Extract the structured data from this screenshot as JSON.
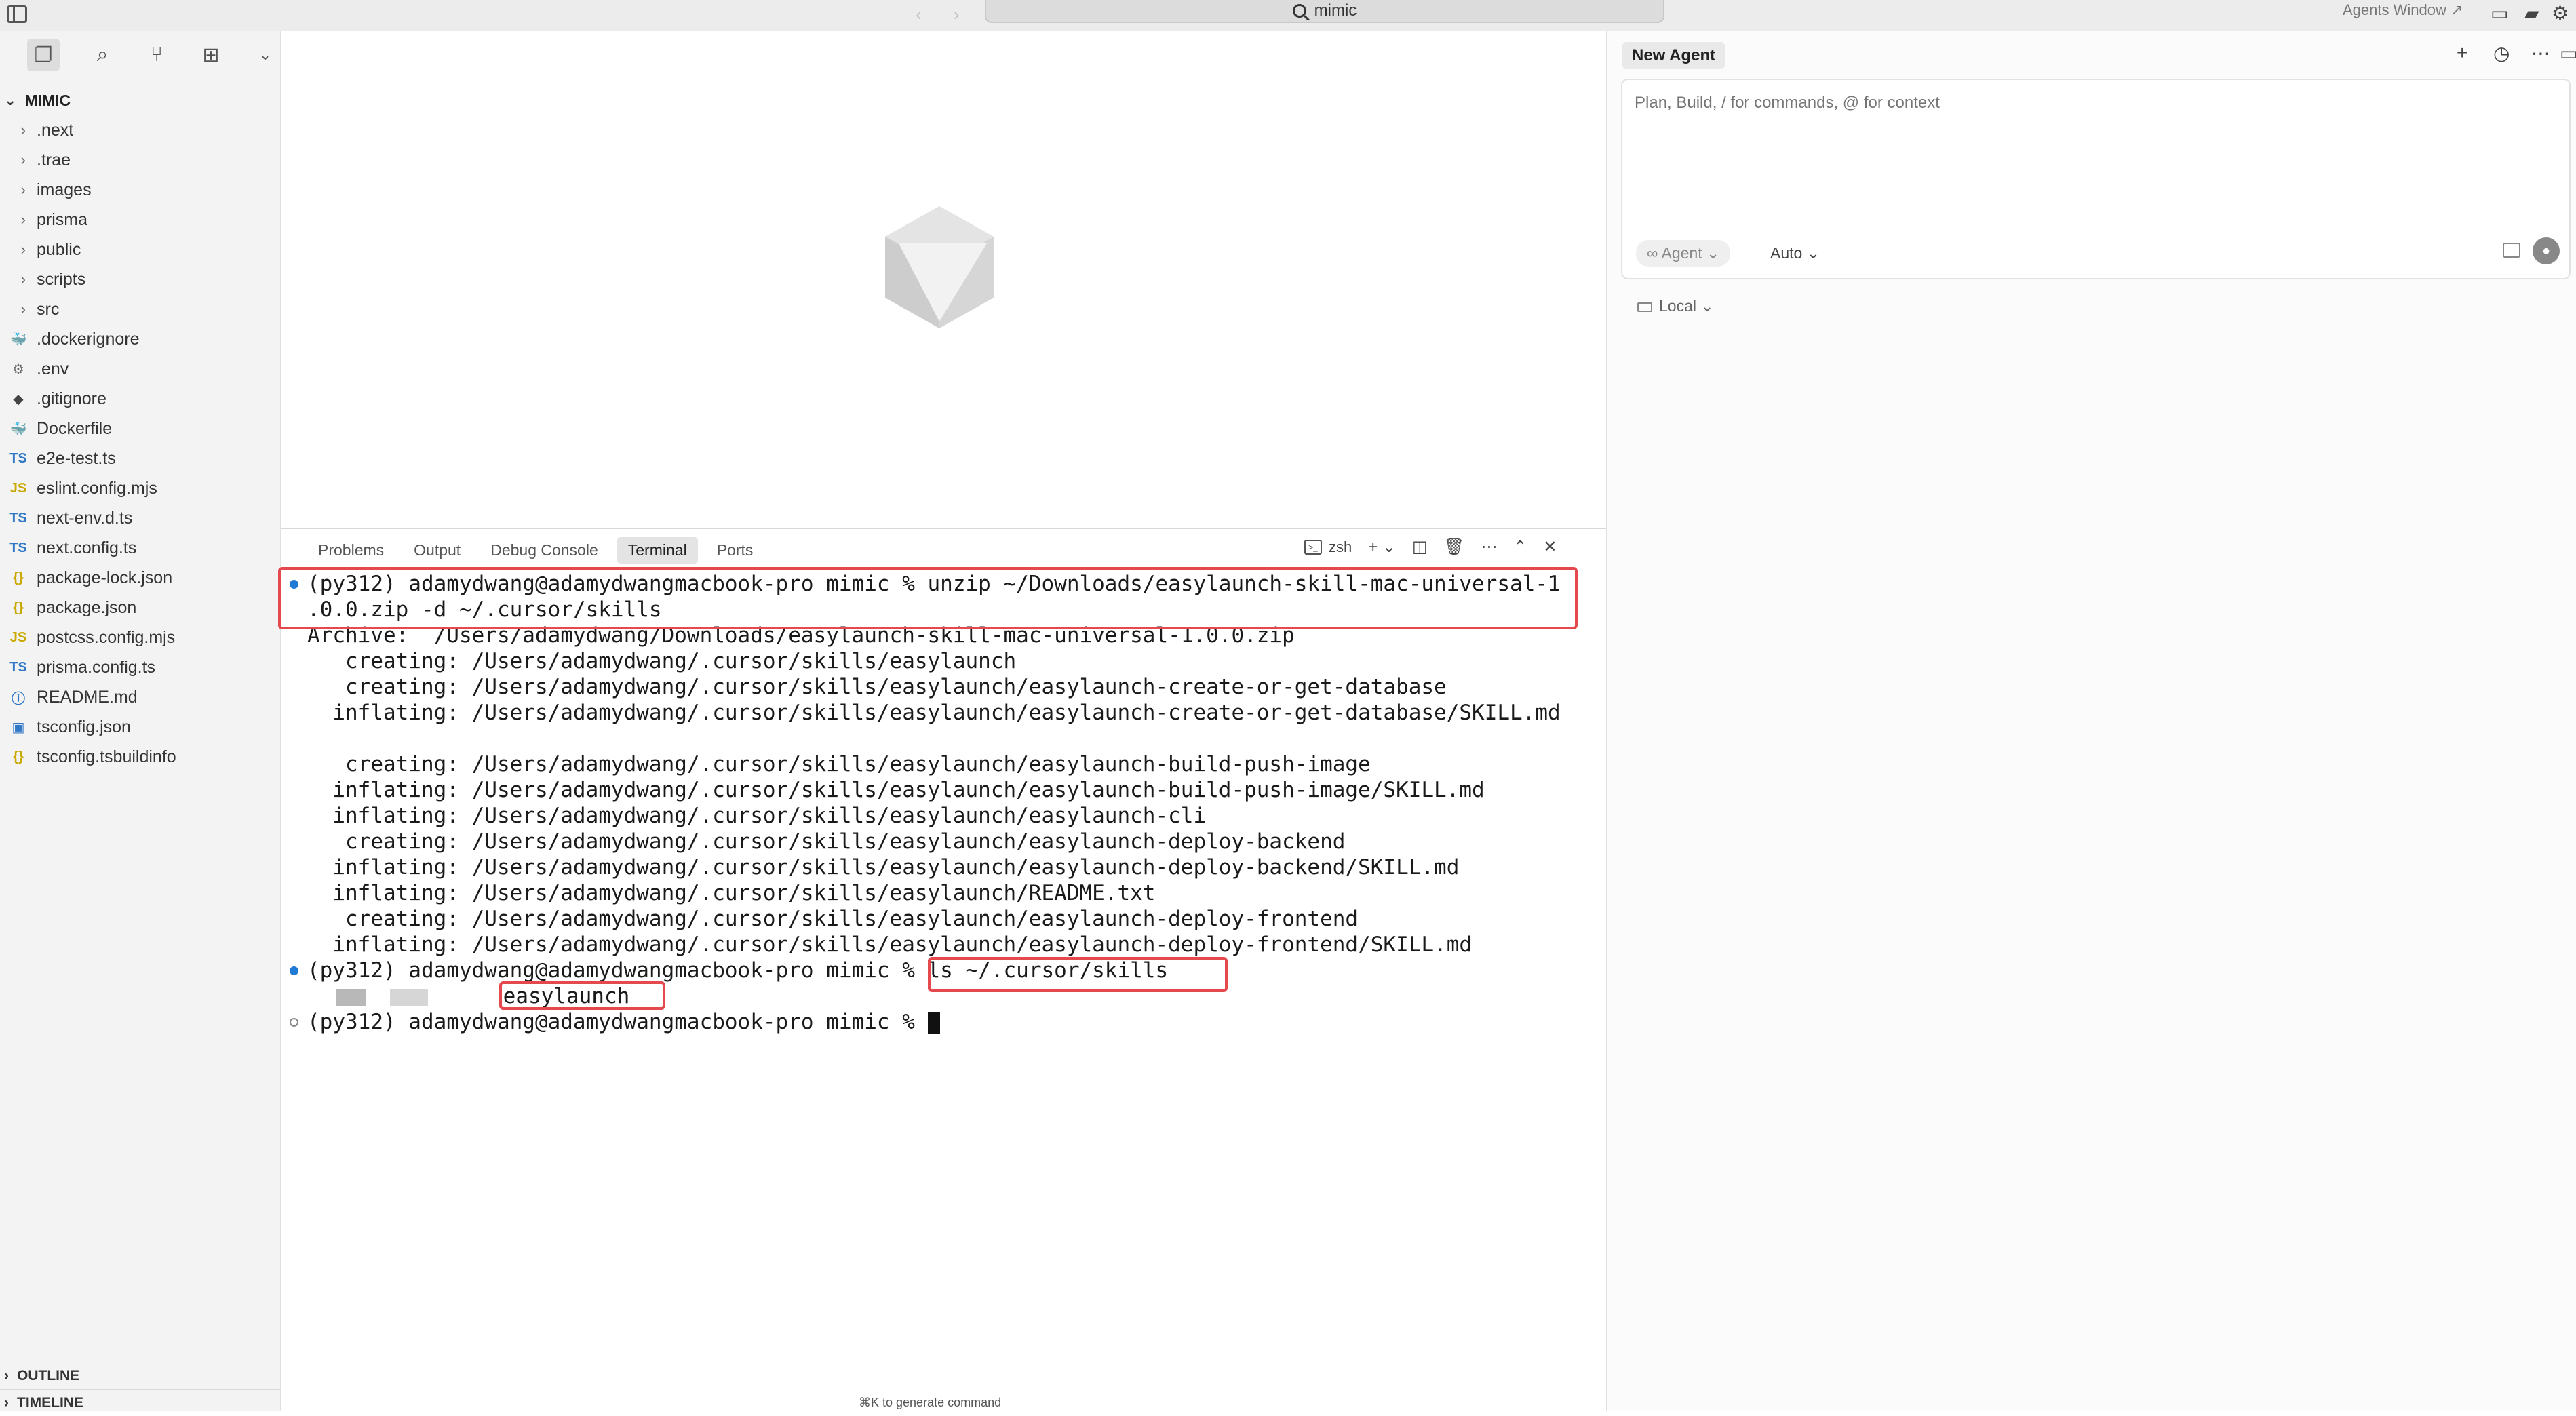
{
  "titlebar": {
    "search_text": "mimic",
    "agents_window_label": "Agents Window ↗"
  },
  "sidebar": {
    "root_label": "MIMIC",
    "items": [
      {
        "label": ".next",
        "type": "folder"
      },
      {
        "label": ".trae",
        "type": "folder"
      },
      {
        "label": "images",
        "type": "folder"
      },
      {
        "label": "prisma",
        "type": "folder"
      },
      {
        "label": "public",
        "type": "folder"
      },
      {
        "label": "scripts",
        "type": "folder"
      },
      {
        "label": "src",
        "type": "folder"
      },
      {
        "label": ".dockerignore",
        "type": "file",
        "icon": "docker-icon",
        "icon_text": "🐳",
        "color": "#3b87c9"
      },
      {
        "label": ".env",
        "type": "file",
        "icon": "gear-icon",
        "icon_text": "⚙",
        "color": "#666666"
      },
      {
        "label": ".gitignore",
        "type": "file",
        "icon": "git-icon",
        "icon_text": "◆",
        "color": "#444444"
      },
      {
        "label": "Dockerfile",
        "type": "file",
        "icon": "docker-icon",
        "icon_text": "🐳",
        "color": "#3b87c9"
      },
      {
        "label": "e2e-test.ts",
        "type": "file",
        "icon": "typescript-icon",
        "icon_text": "TS",
        "color": "#3178c6"
      },
      {
        "label": "eslint.config.mjs",
        "type": "file",
        "icon": "javascript-icon",
        "icon_text": "JS",
        "color": "#c9a800"
      },
      {
        "label": "next-env.d.ts",
        "type": "file",
        "icon": "typescript-icon",
        "icon_text": "TS",
        "color": "#3178c6"
      },
      {
        "label": "next.config.ts",
        "type": "file",
        "icon": "typescript-icon",
        "icon_text": "TS",
        "color": "#3178c6"
      },
      {
        "label": "package-lock.json",
        "type": "file",
        "icon": "json-icon",
        "icon_text": "{}",
        "color": "#c9a800"
      },
      {
        "label": "package.json",
        "type": "file",
        "icon": "json-icon",
        "icon_text": "{}",
        "color": "#c9a800"
      },
      {
        "label": "postcss.config.mjs",
        "type": "file",
        "icon": "javascript-icon",
        "icon_text": "JS",
        "color": "#c9a800"
      },
      {
        "label": "prisma.config.ts",
        "type": "file",
        "icon": "typescript-icon",
        "icon_text": "TS",
        "color": "#3178c6"
      },
      {
        "label": "README.md",
        "type": "file",
        "icon": "info-icon",
        "icon_text": "ⓘ",
        "color": "#3178c6"
      },
      {
        "label": "tsconfig.json",
        "type": "file",
        "icon": "tsconfig-icon",
        "icon_text": "▣",
        "color": "#3178c6"
      },
      {
        "label": "tsconfig.tsbuildinfo",
        "type": "file",
        "icon": "json-icon",
        "icon_text": "{}",
        "color": "#c9a800"
      }
    ],
    "outline_label": "OUTLINE",
    "timeline_label": "TIMELINE"
  },
  "panel": {
    "tabs": [
      "Problems",
      "Output",
      "Debug Console",
      "Terminal",
      "Ports"
    ],
    "active_tab": "Terminal",
    "shell_label": "zsh"
  },
  "terminal": {
    "lines": [
      {
        "text": "(py312) adamydwang@adamydwangmacbook-pro mimic % unzip ~/Downloads/easylaunch-skill-mac-universal-1",
        "dot": "blue"
      },
      {
        "text": ".0.0.zip -d ~/.cursor/skills"
      },
      {
        "text": "Archive:  /Users/adamydwang/Downloads/easylaunch-skill-mac-universal-1.0.0.zip"
      },
      {
        "text": "   creating: /Users/adamydwang/.cursor/skills/easylaunch"
      },
      {
        "text": "   creating: /Users/adamydwang/.cursor/skills/easylaunch/easylaunch-create-or-get-database"
      },
      {
        "text": "  inflating: /Users/adamydwang/.cursor/skills/easylaunch/easylaunch-create-or-get-database/SKILL.md"
      },
      {
        "text": ""
      },
      {
        "text": "   creating: /Users/adamydwang/.cursor/skills/easylaunch/easylaunch-build-push-image"
      },
      {
        "text": "  inflating: /Users/adamydwang/.cursor/skills/easylaunch/easylaunch-build-push-image/SKILL.md"
      },
      {
        "text": "  inflating: /Users/adamydwang/.cursor/skills/easylaunch/easylaunch-cli"
      },
      {
        "text": "   creating: /Users/adamydwang/.cursor/skills/easylaunch/easylaunch-deploy-backend"
      },
      {
        "text": "  inflating: /Users/adamydwang/.cursor/skills/easylaunch/easylaunch-deploy-backend/SKILL.md"
      },
      {
        "text": "  inflating: /Users/adamydwang/.cursor/skills/easylaunch/README.txt"
      },
      {
        "text": "   creating: /Users/adamydwang/.cursor/skills/easylaunch/easylaunch-deploy-frontend"
      },
      {
        "text": "  inflating: /Users/adamydwang/.cursor/skills/easylaunch/easylaunch-deploy-frontend/SKILL.md"
      },
      {
        "text": "(py312) adamydwang@adamydwangmacbook-pro mimic % ls ~/.cursor/skills",
        "dot": "blue"
      },
      {
        "text": "easylaunch",
        "blurred_prefix": true
      },
      {
        "text": "(py312) adamydwang@adamydwangmacbook-pro mimic % ",
        "dot": "hollow",
        "cursor": true
      }
    ],
    "highlight_color": "#e5484d"
  },
  "editor": {
    "hint": "⌘K to generate command"
  },
  "agent": {
    "tab_label": "New Agent",
    "placeholder": "Plan, Build, / for commands, @ for context",
    "mode_label": "∞ Agent ⌄",
    "model_label": "Auto ⌄",
    "location_label": "Local ⌄"
  }
}
